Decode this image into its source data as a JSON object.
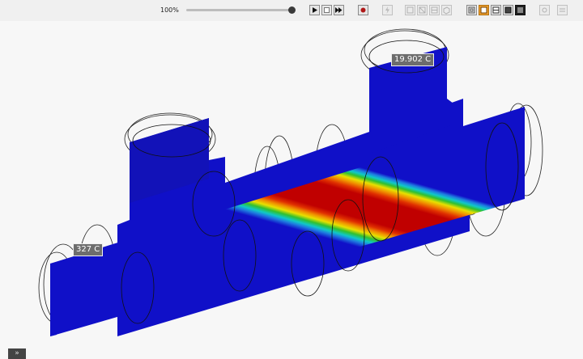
{
  "toolbar": {
    "zoom_label": "100%",
    "progress": 1.0,
    "buttons": [
      {
        "name": "play-icon"
      },
      {
        "name": "stop-icon"
      },
      {
        "name": "fast-forward-icon"
      },
      {
        "name": "record-icon"
      },
      {
        "name": "lightning-icon"
      },
      {
        "name": "view-front-icon"
      },
      {
        "name": "view-side-icon"
      },
      {
        "name": "view-top-icon"
      },
      {
        "name": "view-iso-icon"
      },
      {
        "name": "wireframe-icon"
      },
      {
        "name": "shaded-mode-icon"
      },
      {
        "name": "mesh-mode-icon"
      },
      {
        "name": "solid-mode-icon"
      },
      {
        "name": "grid-icon"
      },
      {
        "name": "settings-icon"
      }
    ]
  },
  "probes": {
    "hot_label": "327 C",
    "cold_label": "19.902 C"
  },
  "colors": {
    "cold": "#1010c8",
    "hot": "#c00000"
  },
  "footer": {
    "collapse_glyph": "»"
  }
}
